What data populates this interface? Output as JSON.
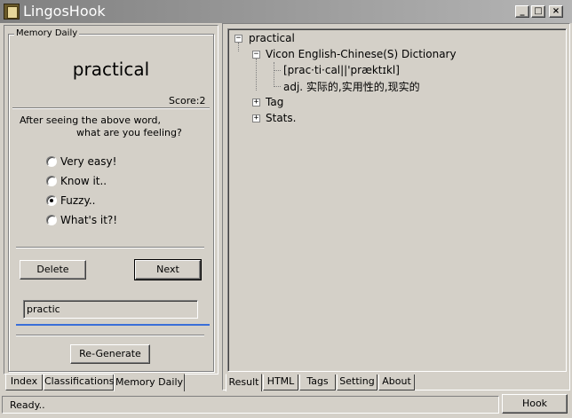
{
  "window": {
    "title": "LingosHook",
    "min_label": "_",
    "max_label": "□",
    "close_label": "×"
  },
  "memory": {
    "group_label": "Memory Daily",
    "word": "practical",
    "score": "Score:2",
    "question_line1": "After seeing the above word,",
    "question_line2": "what are you feeling?",
    "options": [
      {
        "label": "Very easy!",
        "checked": false
      },
      {
        "label": "Know it..",
        "checked": false
      },
      {
        "label": "Fuzzy..",
        "checked": true
      },
      {
        "label": "What's it?!",
        "checked": false
      }
    ],
    "delete_label": "Delete",
    "next_label": "Next",
    "input_value": "practic",
    "regenerate_label": "Re-Generate"
  },
  "left_tabs": [
    "Index",
    "Classifications",
    "Memory Daily"
  ],
  "left_active_tab": "Memory Daily",
  "tree": {
    "root": "practical",
    "dictionary": "Vicon English-Chinese(S) Dictionary",
    "pronunciation": "[prac·ti·cal||'præktɪkl]",
    "definition": "adj. 实际的,实用性的,现实的",
    "tag": "Tag",
    "stats": "Stats."
  },
  "right_tabs": [
    "Result",
    "HTML",
    "Tags",
    "Setting",
    "About"
  ],
  "right_active_tab": "Result",
  "status": {
    "text": "Ready..",
    "hook_label": "Hook"
  }
}
